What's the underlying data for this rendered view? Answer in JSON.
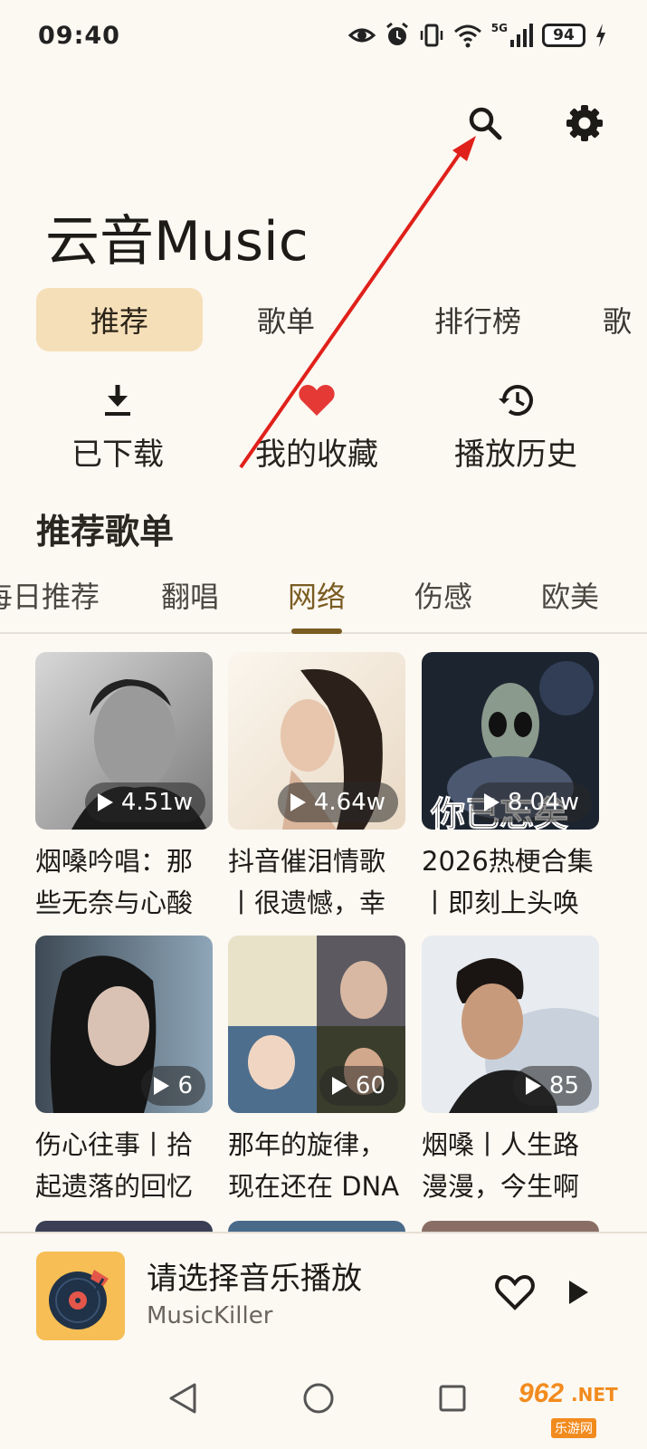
{
  "status_bar": {
    "time": "09:40",
    "network": "5G",
    "battery": "94"
  },
  "app": {
    "title": "云音Music"
  },
  "main_tabs": [
    {
      "label": "推荐"
    },
    {
      "label": "歌单"
    },
    {
      "label": "排行榜"
    },
    {
      "label": "歌"
    }
  ],
  "quick_actions": [
    {
      "label": "已下载",
      "icon": "download-icon"
    },
    {
      "label": "我的收藏",
      "icon": "heart-icon"
    },
    {
      "label": "播放历史",
      "icon": "history-icon"
    }
  ],
  "section": {
    "title": "推荐歌单"
  },
  "category_tabs": [
    {
      "label": "每日推荐"
    },
    {
      "label": "翻唱"
    },
    {
      "label": "网络"
    },
    {
      "label": "伤感"
    },
    {
      "label": "欧美"
    }
  ],
  "playlists": [
    {
      "title": "烟嗓吟唱：那些无奈与心酸",
      "plays": "4.51w"
    },
    {
      "title": "抖音催泪情歌丨很遗憾，幸",
      "plays": "4.64w"
    },
    {
      "title": "2026热梗合集丨即刻上头唤",
      "plays": "8.04w",
      "cover_text": "你已忘矣"
    },
    {
      "title": "伤心往事丨拾起遗落的回忆",
      "plays": "6"
    },
    {
      "title": "那年的旋律，现在还在 DNA",
      "plays": "60"
    },
    {
      "title": "烟嗓丨人生路漫漫，今生啊",
      "plays": "85"
    }
  ],
  "player": {
    "title": "请选择音乐播放",
    "artist": "MusicKiller"
  },
  "watermark": {
    "logo": "962",
    "domain": ".NET",
    "sub": "乐游网"
  },
  "colors": {
    "background": "#fcf8f2",
    "active_tab": "#f5dfb8",
    "accent": "#7a5c22",
    "heart": "#e53935",
    "annotation_arrow": "#e0201a"
  }
}
